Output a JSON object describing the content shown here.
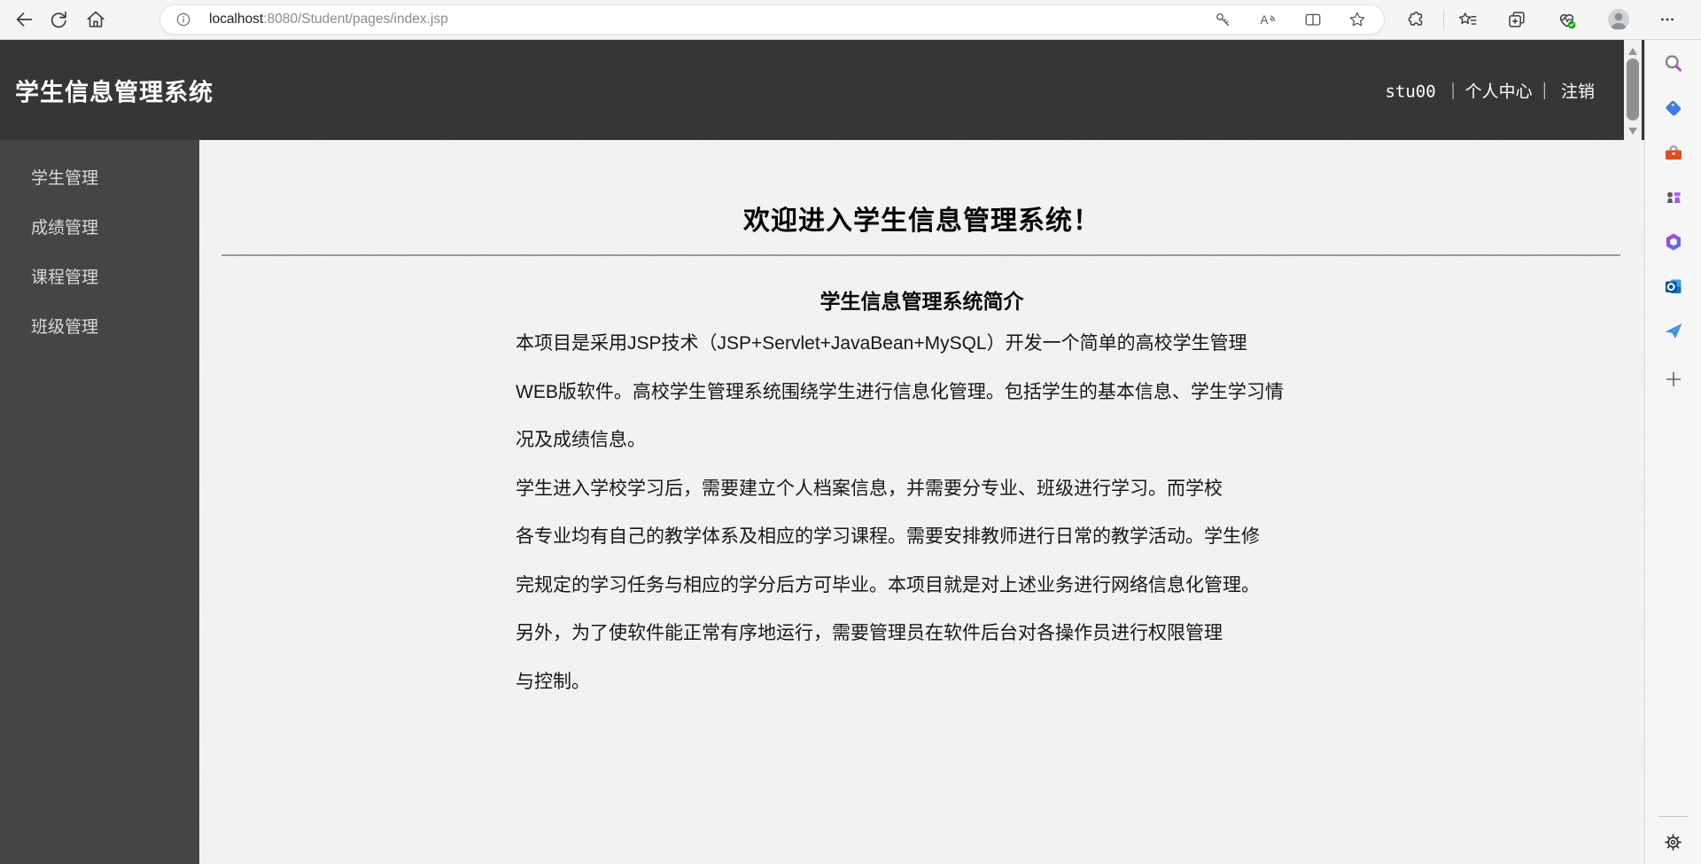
{
  "browser": {
    "url": {
      "host": "localhost",
      "rest": ":8080/Student/pages/index.jsp"
    },
    "toolbar_icons": [
      "back",
      "refresh",
      "home",
      "site-info",
      "password-key",
      "read-aloud",
      "split-screen",
      "favorite-star",
      "extensions",
      "favorites-list",
      "collections",
      "browser-essentials",
      "profile-avatar",
      "more-options"
    ]
  },
  "app": {
    "header": {
      "title": "学生信息管理系统",
      "username": "stu00",
      "separator": "｜",
      "profile_link": "个人中心",
      "logout_link": "注销"
    },
    "sidebar": {
      "items": [
        {
          "label": "学生管理"
        },
        {
          "label": "成绩管理"
        },
        {
          "label": "课程管理"
        },
        {
          "label": "班级管理"
        }
      ]
    },
    "main": {
      "welcome_title": "欢迎进入学生信息管理系统！",
      "intro_title": "学生信息管理系统简介",
      "paragraph_lines": [
        "本项目是采用JSP技术（JSP+Servlet+JavaBean+MySQL）开发一个简单的高校学生管理",
        "WEB版软件。高校学生管理系统围绕学生进行信息化管理。包括学生的基本信息、学生学习情",
        "况及成绩信息。",
        "学生进入学校学习后，需要建立个人档案信息，并需要分专业、班级进行学习。而学校",
        "各专业均有自己的教学体系及相应的学习课程。需要安排教师进行日常的教学活动。学生修",
        "完规定的学习任务与相应的学分后方可毕业。本项目就是对上述业务进行网络信息化管理。",
        "另外，为了使软件能正常有序地运行，需要管理员在软件后台对各操作员进行权限管理",
        "与控制。"
      ]
    }
  },
  "edge_rail": {
    "icons": [
      "search",
      "shopping",
      "tools",
      "games",
      "microsoft-365",
      "outlook",
      "drop",
      "add",
      "settings"
    ]
  },
  "colors": {
    "toolbar_bg": "#f5f5f5",
    "header_bg": "#363636",
    "sidebar_bg": "#454545",
    "main_bg": "#f2f1ef",
    "menu_text": "#d9d9d9",
    "header_text": "#ffffff",
    "body_text": "#171717",
    "essentials_badge_green": "#13a10e",
    "outlook_blue": "#1173c7",
    "shopping_tag_blue": "#3f7bea",
    "toolbox_orange": "#df4d23",
    "games_purple": "#a35bf0",
    "search_handle_purple": "#c43fd6",
    "drop_plane_blue": "#3d8df5",
    "drop_fold_yellow": "#fbbf24"
  }
}
